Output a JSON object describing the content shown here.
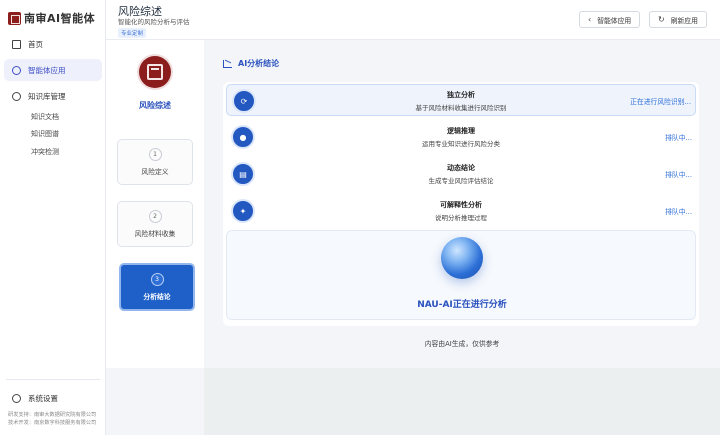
{
  "brand": {
    "logo_text": "南审AI智能体"
  },
  "sidebar": {
    "items": [
      {
        "label": "首页",
        "icon": "home-icon",
        "active": false
      },
      {
        "label": "智能体应用",
        "icon": "compass-icon",
        "active": true
      },
      {
        "label": "知识库管理",
        "icon": "database-icon",
        "active": false
      }
    ],
    "sub_items": [
      {
        "label": "知识文档"
      },
      {
        "label": "知识图谱"
      },
      {
        "label": "冲突检测"
      }
    ],
    "settings_label": "系统设置",
    "footer": [
      "研发支持：南审大数据研究院有限公司",
      "技术开发：南京数字科技服务有限公司"
    ]
  },
  "header": {
    "title": "风险综述",
    "subtitle": "智能化的风险分析与评估",
    "tag": "专业定制",
    "back_button": "智能体应用",
    "refresh_button": "刷新应用"
  },
  "steps": {
    "title": "风险综述",
    "items": [
      {
        "num": "1",
        "label": "风险定义",
        "active": false
      },
      {
        "num": "2",
        "label": "风险材料收集",
        "active": false
      },
      {
        "num": "3",
        "label": "分析结论",
        "active": true
      }
    ]
  },
  "analysis": {
    "section_title": "AI分析结论",
    "rows": [
      {
        "title": "独立分析",
        "desc": "基于风险材料收集进行风险识别",
        "status": "正在进行风险识别...",
        "icon": "sync-icon"
      },
      {
        "title": "逻辑推理",
        "desc": "运用专业知识进行风险分类",
        "status": "排队中...",
        "icon": "brain-icon"
      },
      {
        "title": "动态结论",
        "desc": "生成专业风险评估结论",
        "status": "排队中...",
        "icon": "document-icon"
      },
      {
        "title": "可解释性分析",
        "desc": "说明分析推理过程",
        "status": "排队中...",
        "icon": "lightbulb-icon"
      }
    ],
    "ai_status": "NAU-AI正在进行分析",
    "disclaimer": "内容由AI生成，仅供参考"
  },
  "colors": {
    "accent": "#2a52be",
    "brand": "#8c1d1d",
    "active_step": "#1e60c8"
  }
}
